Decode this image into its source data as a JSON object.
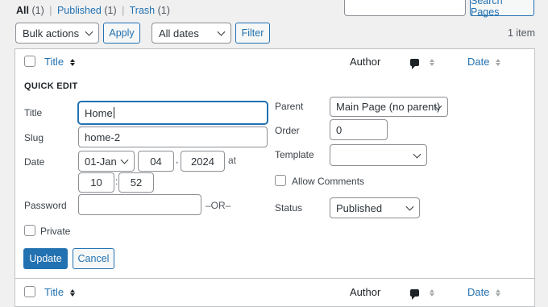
{
  "filters": {
    "all_label": "All",
    "all_count": "(1)",
    "published_label": "Published",
    "published_count": "(1)",
    "trash_label": "Trash",
    "trash_count": "(1)",
    "separator": "|"
  },
  "search": {
    "button_label": "Search Pages",
    "value": ""
  },
  "toolbar": {
    "bulk_actions": "Bulk actions",
    "apply_label": "Apply",
    "dates_select": "All dates",
    "filter_label": "Filter",
    "item_count": "1 item"
  },
  "columns": {
    "title": "Title",
    "author": "Author",
    "date": "Date"
  },
  "quick_edit": {
    "heading": "QUICK EDIT",
    "title_label": "Title",
    "title_value": "Home",
    "slug_label": "Slug",
    "slug_value": "home-2",
    "date_label": "Date",
    "month_value": "01-Jan",
    "day_value": "04",
    "year_value": "2024",
    "comma": ",",
    "at_label": "at",
    "hour_value": "10",
    "time_sep": ":",
    "minute_value": "52",
    "password_label": "Password",
    "password_value": "",
    "or_label": "–OR–",
    "private_label": "Private",
    "parent_label": "Parent",
    "parent_value": "Main Page (no parent)",
    "order_label": "Order",
    "order_value": "0",
    "template_label": "Template",
    "template_value": "",
    "allow_comments_label": "Allow Comments",
    "status_label": "Status",
    "status_value": "Published",
    "update_label": "Update",
    "cancel_label": "Cancel"
  }
}
